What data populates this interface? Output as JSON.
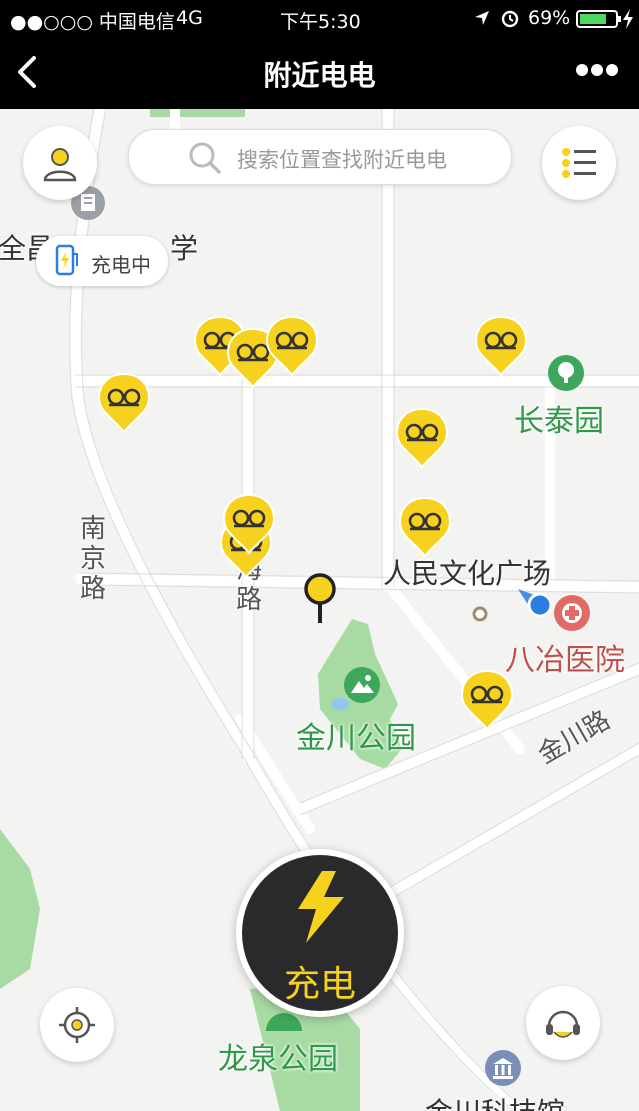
{
  "status_bar": {
    "carrier": "●●○○○ 中国电信",
    "network": "4G",
    "time": "下午5:30",
    "battery": "69%"
  },
  "nav": {
    "title": "附近电电",
    "back_icon": "chevron-left-icon",
    "more_icon": "more-dots-icon"
  },
  "search": {
    "placeholder": "搜索位置查找附近电电"
  },
  "charging_badge": {
    "label": "充电中"
  },
  "map": {
    "school_partial_left": "全昌",
    "school_partial_right": "学",
    "roads": {
      "nanjing": "南京路",
      "hai": "海",
      "lu": "路",
      "jinchuan": "金川路"
    },
    "places": {
      "changtai_park": "长泰园",
      "renmin_square": "人民文化广场",
      "bayie_hospital": "八冶医院",
      "jinchuan_park": "金川公园",
      "longquan_park": "龙泉公园",
      "science_museum": "金川科技馆"
    }
  },
  "charge_button": {
    "label": "充电"
  },
  "colors": {
    "accent_yellow": "#f6d21e",
    "park_green": "#2e9a48",
    "hospital_red": "#c0504d",
    "bar_black": "#000000"
  }
}
